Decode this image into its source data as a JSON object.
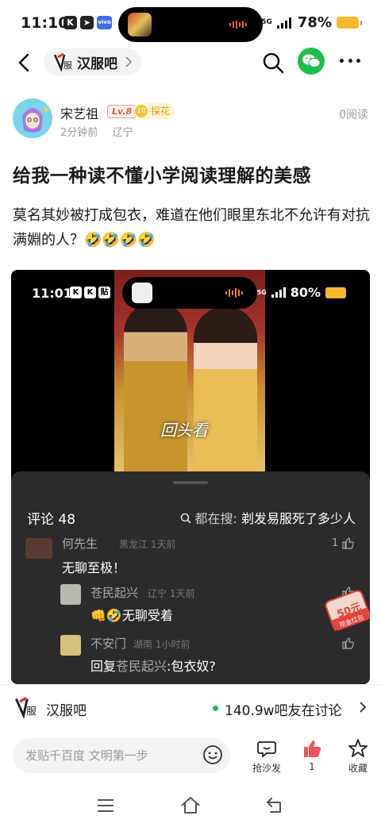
{
  "status_bar": {
    "time": "11:10",
    "network": "5G",
    "battery": "78%"
  },
  "nav": {
    "forum_name": "汉服吧"
  },
  "author": {
    "name": "宋艺祖",
    "level": "Lv.8",
    "badge_num": "10",
    "badge": "探花",
    "time": "2分钟前",
    "location": "辽宁",
    "reads": "0阅读"
  },
  "post": {
    "title": "给我一种读不懂小学阅读理解的美感",
    "body": "莫名其妙被打成包衣，难道在他们眼里东北不允许有对抗满婣的人？🤣🤣🤣🤣"
  },
  "screenshot": {
    "status_time": "11:01",
    "status_icon_label": "贴",
    "network": "5G",
    "battery": "80%",
    "video_caption": "回头看",
    "comments_count": "评论 48",
    "search_hint": "都在搜:",
    "search_keyword": "剃发易服死了多少人",
    "comments": [
      {
        "name": "何先生",
        "meta": "黑龙江 1天前",
        "text": "无聊至极！",
        "likes": "1"
      },
      {
        "name": "苍民起兴",
        "meta": "辽宁 1天前",
        "text": "👊🤣无聊受着",
        "likes": ""
      },
      {
        "name": "不安门",
        "meta": "湖南 1小时前",
        "text_prefix": "回复",
        "text_target": "苍民起兴",
        "text_rest": ":包衣奴?",
        "likes": ""
      }
    ],
    "stamp_amount": "50元",
    "stamp_label": "现金红包"
  },
  "forum_bar": {
    "name": "汉服吧",
    "online": "140.9w吧友在讨论"
  },
  "action_bar": {
    "input_placeholder": "发贴千百度 文明第一步",
    "sofa_label": "抢沙发",
    "like_count": "1",
    "favorite_label": "收藏"
  },
  "colors": {
    "accent_green": "#1cbf49",
    "like_red": "#f0525d",
    "badge_gold": "#f7c12e"
  }
}
